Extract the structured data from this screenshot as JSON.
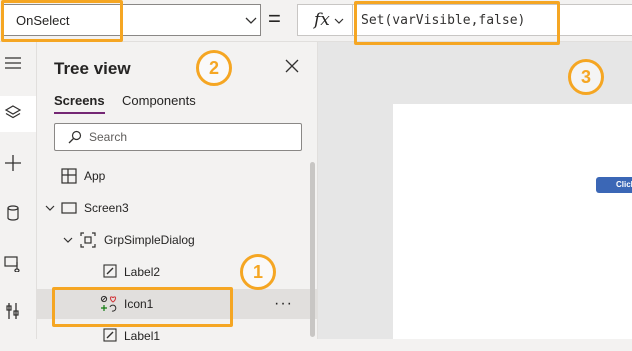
{
  "formula_bar": {
    "property": "OnSelect",
    "equals": "=",
    "fx_label": "fx",
    "formula": "Set(varVisible,false)"
  },
  "left_rail": {
    "items": [
      "menu-icon",
      "layers-icon",
      "add-icon",
      "database-icon",
      "media-icon",
      "tools-icon"
    ]
  },
  "tree_view": {
    "title": "Tree view",
    "tabs": [
      "Screens",
      "Components"
    ],
    "active_tab": "Screens",
    "search_placeholder": "Search",
    "nodes": [
      {
        "label": "App",
        "icon": "app-icon"
      },
      {
        "label": "Screen3",
        "icon": "screen-icon",
        "expanded": true
      },
      {
        "label": "GrpSimpleDialog",
        "icon": "group-icon",
        "expanded": true
      },
      {
        "label": "Label2",
        "icon": "label-icon"
      },
      {
        "label": "Icon1",
        "icon": "icon-control-icon",
        "selected": true
      },
      {
        "label": "Label1",
        "icon": "label-icon"
      }
    ],
    "more_label": "···"
  },
  "canvas": {
    "button_text": "Click"
  },
  "annotations": {
    "badge_1": "1",
    "badge_2": "2",
    "badge_3": "3",
    "accent": "#f5a623"
  },
  "colors": {
    "tab_underline": "#742774",
    "selected_row": "#e1dfdd",
    "canvas_button": "#3b67b6"
  }
}
